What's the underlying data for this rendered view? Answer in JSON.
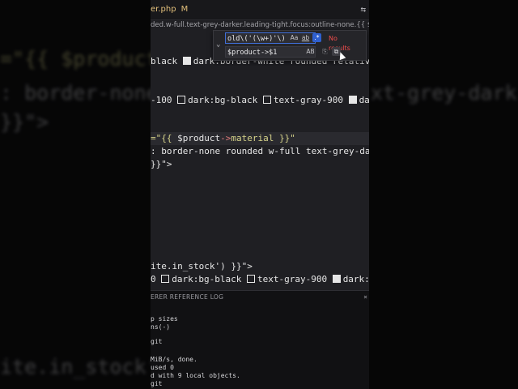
{
  "background": {
    "lines": [
      {
        "segments": [
          {
            "t": "=\"{{ $product",
            "c": "str"
          }
        ]
      },
      {
        "segments": [
          {
            "t": ": border-none",
            "c": "plain"
          }
        ]
      },
      {
        "segments": [
          {
            "t": "}}\">",
            "c": "plain"
          }
        ]
      },
      {
        "segments": [
          {
            "t": "ite.in_stock'",
            "c": "plain"
          }
        ]
      }
    ],
    "right_lines": [
      {
        "segments": [
          {
            "t": "xt-grey-darke",
            "c": "plain"
          }
        ]
      }
    ]
  },
  "tabbar": {
    "file_tab": "er.php",
    "modified_badge": "M"
  },
  "breadcrumb": "ded.w-full.text-grey-darker.leading-tight.focus:outline-none.{{ $errors->has(ma",
  "find_widget": {
    "find_value": "old\\('(\\w+)'\\)",
    "replace_value": "$product->$1",
    "no_results": "No results",
    "match_case": "Aa",
    "match_word": "ab",
    "regex": ".*",
    "preserve_case": "AB"
  },
  "code": {
    "line1": "black",
    "line1b": "dark:border-white rounded relative",
    "line2a": "-100",
    "line2b": "dark:bg-black",
    "line2c": "text-gray-900",
    "line2d": "dark:t",
    "line3_pre": "=\"{{ ",
    "line3_var": "$product",
    "line3_op": "->",
    "line3_post": "material }}\"",
    "line4": ": border-none rounded w-full text-grey-darke",
    "line5": "}}\">",
    "line6": "ite.in_stock') }}\">",
    "line7a": "0",
    "line7b": "dark:bg-black",
    "line7c": "text-gray-900",
    "line7d": "dark:te"
  },
  "terminal": {
    "tab_label": "ERER REFERENCE LOG",
    "lines": [
      "p sizes",
      "ns(-)",
      "git",
      "MiB/s, done.",
      "used 0",
      "d with 9 local objects.",
      "git"
    ]
  }
}
